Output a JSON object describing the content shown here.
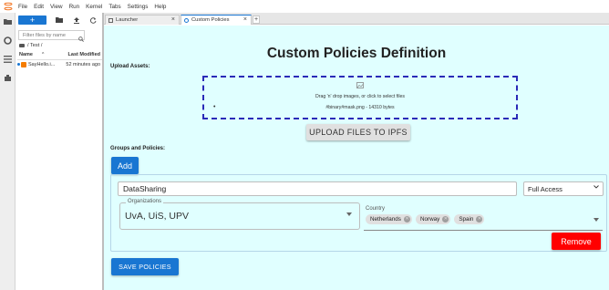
{
  "menubar": {
    "items": [
      "File",
      "Edit",
      "View",
      "Run",
      "Kernel",
      "Tabs",
      "Settings",
      "Help"
    ]
  },
  "activity_bar": {
    "icons": [
      "folder-icon",
      "running-icon",
      "toc-icon",
      "extension-icon"
    ]
  },
  "file_browser": {
    "new_label": "+",
    "search_placeholder": "Filter files by name",
    "breadcrumb": "/ Test /",
    "columns": {
      "name": "Name",
      "sort_caret": "^",
      "modified": "Last Modified"
    },
    "files": [
      {
        "name": "SayHello.i...",
        "modified": "52 minutes ago"
      }
    ]
  },
  "tabs": [
    {
      "label": "Launcher",
      "active": false
    },
    {
      "label": "Custom Policies",
      "active": true
    }
  ],
  "page": {
    "title": "Custom Policies Definition",
    "upload_assets_label": "Upload Assets:",
    "dropzone": {
      "instructions": "Drag 'n' drop images, or click to select files",
      "file_entry": "#binary#mask.png - 14310 bytes"
    },
    "upload_button": "UPLOAD FILES TO IPFS",
    "groups_label": "Groups and Policies:",
    "add_button": "Add",
    "group": {
      "name": "DataSharing",
      "access": "Full Access",
      "organizations_label": "Organizations",
      "organizations_value": "UvA, UiS, UPV",
      "country_label": "Country",
      "countries": [
        "Netherlands",
        "Norway",
        "Spain"
      ],
      "remove_button": "Remove"
    },
    "save_button": "SAVE POLICIES"
  },
  "colors": {
    "content_bg": "#e0ffff",
    "primary": "#1976d2",
    "danger": "#ff0000",
    "dropzone_border": "#2a2ab8"
  }
}
